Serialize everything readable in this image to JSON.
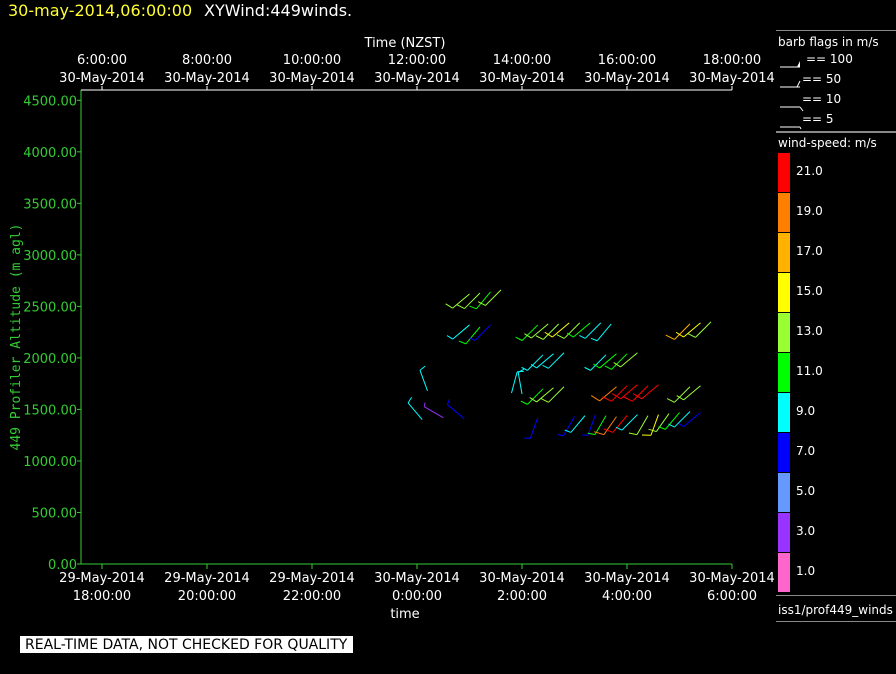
{
  "header": {
    "timestamp": "30-may-2014,06:00:00",
    "product": "XYWind:449winds."
  },
  "legend": {
    "barb_title": "barb flags in m/s",
    "barbs": [
      {
        "label": "== 100"
      },
      {
        "label": "== 50"
      },
      {
        "label": "== 10"
      },
      {
        "label": "== 5"
      }
    ],
    "speed_title": "wind-speed: m/s",
    "speed_bins": [
      {
        "label": "21.0",
        "color": "#ff0000"
      },
      {
        "label": "19.0",
        "color": "#ff8000"
      },
      {
        "label": "17.0",
        "color": "#ffb300"
      },
      {
        "label": "15.0",
        "color": "#ffff00"
      },
      {
        "label": "13.0",
        "color": "#99ff33"
      },
      {
        "label": "11.0",
        "color": "#00ff00"
      },
      {
        "label": "9.0",
        "color": "#00ffff"
      },
      {
        "label": "7.0",
        "color": "#0000ff"
      },
      {
        "label": "5.0",
        "color": "#6699ff"
      },
      {
        "label": "3.0",
        "color": "#9933ff"
      },
      {
        "label": "1.0",
        "color": "#ff66cc"
      }
    ],
    "source": "iss1/prof449_winds"
  },
  "quality_note": "REAL-TIME DATA, NOT CHECKED FOR QUALITY",
  "chart_data": {
    "type": "scatter",
    "title": "",
    "top_axis_label": "Time (NZST)",
    "bottom_axis_label": "time",
    "ylabel": "449 Profiler Altitude (m agl)",
    "ylim": [
      0,
      4600
    ],
    "xlim_hours_utc": [
      17.6,
      30.0
    ],
    "y_ticks": [
      "0.00",
      "500.00",
      "1000.00",
      "1500.00",
      "2000.00",
      "2500.00",
      "3000.00",
      "3500.00",
      "4000.00",
      "4500.00"
    ],
    "bottom_ticks": [
      {
        "date": "29-May-2014",
        "time": "18:00:00"
      },
      {
        "date": "29-May-2014",
        "time": "20:00:00"
      },
      {
        "date": "29-May-2014",
        "time": "22:00:00"
      },
      {
        "date": "30-May-2014",
        "time": "0:00:00"
      },
      {
        "date": "30-May-2014",
        "time": "2:00:00"
      },
      {
        "date": "30-May-2014",
        "time": "4:00:00"
      },
      {
        "date": "30-May-2014",
        "time": "6:00:00"
      }
    ],
    "top_ticks": [
      {
        "time": "6:00:00",
        "date": "30-May-2014"
      },
      {
        "time": "8:00:00",
        "date": "30-May-2014"
      },
      {
        "time": "10:00:00",
        "date": "30-May-2014"
      },
      {
        "time": "12:00:00",
        "date": "30-May-2014"
      },
      {
        "time": "14:00:00",
        "date": "30-May-2014"
      },
      {
        "time": "16:00:00",
        "date": "30-May-2014"
      },
      {
        "time": "18:00:00",
        "date": "30-May-2014"
      }
    ],
    "wind_barbs": [
      {
        "t": 24.1,
        "alt": 1400,
        "speed": 9,
        "dir": 320
      },
      {
        "t": 24.5,
        "alt": 1420,
        "speed": 3,
        "dir": 300
      },
      {
        "t": 24.9,
        "alt": 1410,
        "speed": 7,
        "dir": 310
      },
      {
        "t": 24.2,
        "alt": 1680,
        "speed": 9,
        "dir": 340
      },
      {
        "t": 25.0,
        "alt": 2320,
        "speed": 9,
        "dir": 230
      },
      {
        "t": 25.2,
        "alt": 2300,
        "speed": 11,
        "dir": 220
      },
      {
        "t": 25.4,
        "alt": 2320,
        "speed": 7,
        "dir": 225
      },
      {
        "t": 25.0,
        "alt": 2620,
        "speed": 13,
        "dir": 230
      },
      {
        "t": 25.2,
        "alt": 2630,
        "speed": 13,
        "dir": 225
      },
      {
        "t": 25.4,
        "alt": 2640,
        "speed": 11,
        "dir": 220
      },
      {
        "t": 25.6,
        "alt": 2660,
        "speed": 13,
        "dir": 225
      },
      {
        "t": 25.8,
        "alt": 1660,
        "speed": 9,
        "dir": 15
      },
      {
        "t": 26.0,
        "alt": 1650,
        "speed": 9,
        "dir": 350
      },
      {
        "t": 26.3,
        "alt": 1420,
        "speed": 7,
        "dir": 200
      },
      {
        "t": 26.4,
        "alt": 1700,
        "speed": 11,
        "dir": 225
      },
      {
        "t": 26.6,
        "alt": 1710,
        "speed": 13,
        "dir": 230
      },
      {
        "t": 26.8,
        "alt": 1720,
        "speed": 13,
        "dir": 225
      },
      {
        "t": 26.4,
        "alt": 2030,
        "speed": 9,
        "dir": 225
      },
      {
        "t": 26.6,
        "alt": 2040,
        "speed": 9,
        "dir": 230
      },
      {
        "t": 26.8,
        "alt": 2050,
        "speed": 9,
        "dir": 225
      },
      {
        "t": 26.3,
        "alt": 2320,
        "speed": 11,
        "dir": 225
      },
      {
        "t": 26.5,
        "alt": 2330,
        "speed": 13,
        "dir": 230
      },
      {
        "t": 26.7,
        "alt": 2330,
        "speed": 13,
        "dir": 225
      },
      {
        "t": 26.9,
        "alt": 2340,
        "speed": 15,
        "dir": 230
      },
      {
        "t": 27.1,
        "alt": 2340,
        "speed": 13,
        "dir": 225
      },
      {
        "t": 27.3,
        "alt": 2340,
        "speed": 11,
        "dir": 230
      },
      {
        "t": 27.5,
        "alt": 2340,
        "speed": 9,
        "dir": 225
      },
      {
        "t": 27.7,
        "alt": 2330,
        "speed": 9,
        "dir": 220
      },
      {
        "t": 27.6,
        "alt": 2030,
        "speed": 9,
        "dir": 225
      },
      {
        "t": 27.8,
        "alt": 2040,
        "speed": 11,
        "dir": 230
      },
      {
        "t": 28.0,
        "alt": 2040,
        "speed": 11,
        "dir": 225
      },
      {
        "t": 28.2,
        "alt": 2050,
        "speed": 13,
        "dir": 230
      },
      {
        "t": 27.0,
        "alt": 1430,
        "speed": 7,
        "dir": 210
      },
      {
        "t": 27.2,
        "alt": 1440,
        "speed": 9,
        "dir": 220
      },
      {
        "t": 27.4,
        "alt": 1450,
        "speed": 7,
        "dir": 200
      },
      {
        "t": 27.6,
        "alt": 1440,
        "speed": 11,
        "dir": 210
      },
      {
        "t": 27.8,
        "alt": 1430,
        "speed": 19,
        "dir": 215
      },
      {
        "t": 28.0,
        "alt": 1440,
        "speed": 21,
        "dir": 220
      },
      {
        "t": 28.2,
        "alt": 1450,
        "speed": 9,
        "dir": 225
      },
      {
        "t": 28.4,
        "alt": 1440,
        "speed": 13,
        "dir": 210
      },
      {
        "t": 28.6,
        "alt": 1450,
        "speed": 15,
        "dir": 200
      },
      {
        "t": 28.8,
        "alt": 1460,
        "speed": 13,
        "dir": 215
      },
      {
        "t": 29.0,
        "alt": 1470,
        "speed": 11,
        "dir": 220
      },
      {
        "t": 29.2,
        "alt": 1480,
        "speed": 9,
        "dir": 225
      },
      {
        "t": 29.4,
        "alt": 1470,
        "speed": 7,
        "dir": 230
      },
      {
        "t": 27.8,
        "alt": 1720,
        "speed": 19,
        "dir": 230
      },
      {
        "t": 28.0,
        "alt": 1730,
        "speed": 21,
        "dir": 225
      },
      {
        "t": 28.2,
        "alt": 1740,
        "speed": 21,
        "dir": 230
      },
      {
        "t": 28.4,
        "alt": 1730,
        "speed": 21,
        "dir": 225
      },
      {
        "t": 28.6,
        "alt": 1740,
        "speed": 21,
        "dir": 230
      },
      {
        "t": 29.2,
        "alt": 1720,
        "speed": 13,
        "dir": 225
      },
      {
        "t": 29.4,
        "alt": 1730,
        "speed": 13,
        "dir": 230
      },
      {
        "t": 29.2,
        "alt": 2330,
        "speed": 17,
        "dir": 225
      },
      {
        "t": 29.4,
        "alt": 2340,
        "speed": 15,
        "dir": 230
      },
      {
        "t": 29.6,
        "alt": 2350,
        "speed": 13,
        "dir": 225
      }
    ]
  }
}
